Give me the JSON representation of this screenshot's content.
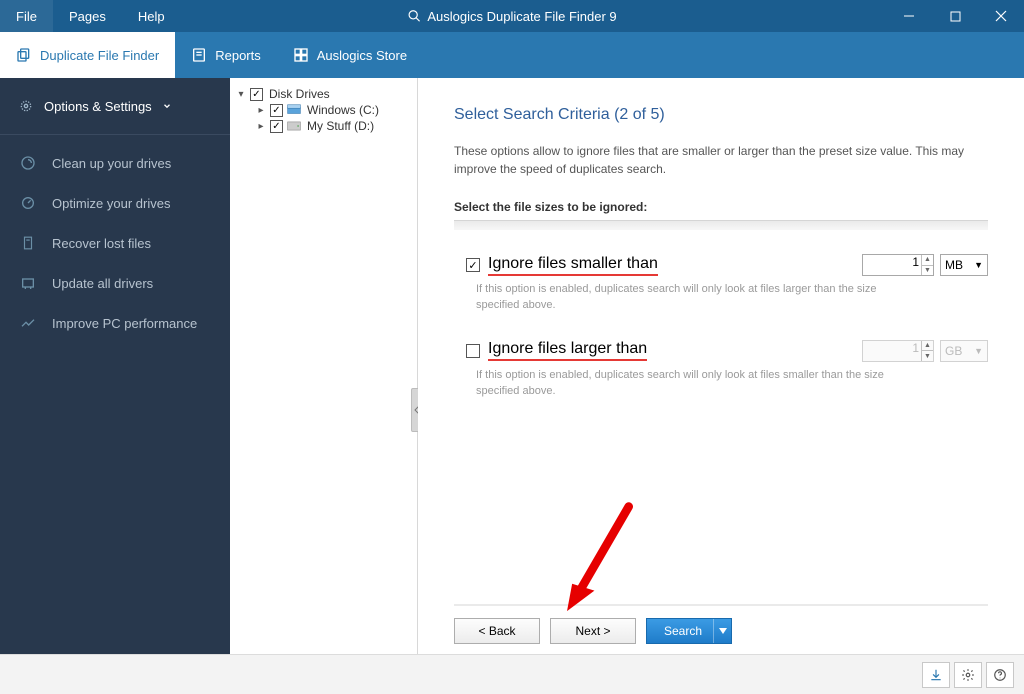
{
  "titlebar": {
    "menu": [
      "File",
      "Pages",
      "Help"
    ],
    "app_title": "Auslogics Duplicate File Finder 9"
  },
  "tabs": [
    {
      "label": "Duplicate File Finder",
      "active": true
    },
    {
      "label": "Reports",
      "active": false
    },
    {
      "label": "Auslogics Store",
      "active": false
    }
  ],
  "sidebar": {
    "top": "Options & Settings",
    "items": [
      "Clean up your drives",
      "Optimize your drives",
      "Recover lost files",
      "Update all drivers",
      "Improve PC performance"
    ]
  },
  "tree": {
    "root": "Disk Drives",
    "children": [
      {
        "label": "Windows (C:)",
        "icon": "drive"
      },
      {
        "label": "My Stuff (D:)",
        "icon": "drive"
      }
    ]
  },
  "content": {
    "heading": "Select Search Criteria (2 of 5)",
    "description": "These options allow to ignore files that are smaller or larger than the preset size value. This may improve the speed of duplicates search.",
    "section_label": "Select the file sizes to be ignored:",
    "opt_smaller": {
      "checked": true,
      "label": "Ignore files smaller than",
      "help": "If this option is enabled, duplicates search will only look at files larger than the size specified above.",
      "value": "1",
      "unit": "MB"
    },
    "opt_larger": {
      "checked": false,
      "label": "Ignore files larger than",
      "help": "If this option is enabled, duplicates search will only look at files smaller than the size specified above.",
      "value": "1",
      "unit": "GB"
    },
    "buttons": {
      "back": "< Back",
      "next": "Next >",
      "search": "Search"
    }
  }
}
